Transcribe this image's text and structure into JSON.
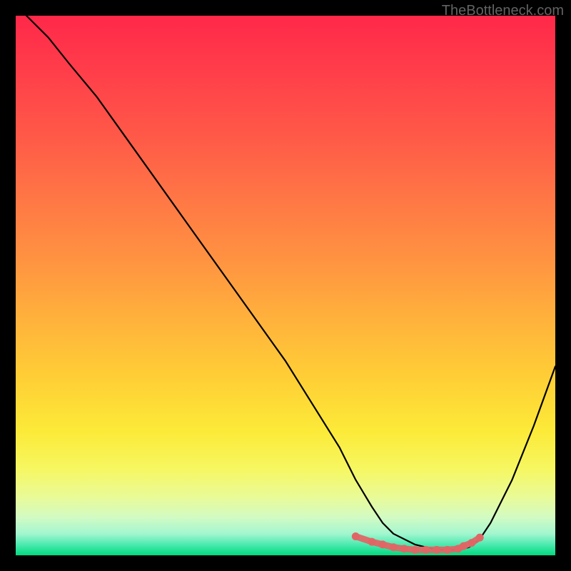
{
  "attribution": "TheBottleneck.com",
  "chart_data": {
    "type": "line",
    "title": "",
    "xlabel": "",
    "ylabel": "",
    "xlim": [
      0,
      100
    ],
    "ylim": [
      0,
      100
    ],
    "series": [
      {
        "name": "main-curve",
        "color": "#000000",
        "x": [
          2,
          6,
          10,
          15,
          20,
          25,
          30,
          35,
          40,
          45,
          50,
          55,
          60,
          63,
          66,
          68,
          70,
          74,
          78,
          82,
          84,
          86,
          88,
          92,
          96,
          100
        ],
        "y": [
          100,
          96,
          91,
          85,
          78,
          71,
          64,
          57,
          50,
          43,
          36,
          28,
          20,
          14,
          9,
          6,
          4,
          2,
          1,
          1,
          1.5,
          3,
          6,
          14,
          24,
          35
        ]
      },
      {
        "name": "highlight-dots",
        "color": "#e06666",
        "x": [
          63,
          66,
          68,
          70,
          72,
          74,
          76,
          78,
          80,
          82,
          83,
          84.5,
          86
        ],
        "y": [
          3.5,
          2.5,
          2,
          1.5,
          1.2,
          1,
          1,
          1,
          1,
          1.2,
          1.7,
          2.3,
          3.3
        ]
      }
    ],
    "gradient_stops": [
      {
        "pos": 0,
        "color": "#ff2849"
      },
      {
        "pos": 9,
        "color": "#ff3b4a"
      },
      {
        "pos": 22,
        "color": "#ff5848"
      },
      {
        "pos": 34,
        "color": "#ff7745"
      },
      {
        "pos": 45,
        "color": "#ff9241"
      },
      {
        "pos": 56,
        "color": "#ffb13c"
      },
      {
        "pos": 68,
        "color": "#ffd135"
      },
      {
        "pos": 77,
        "color": "#fcea38"
      },
      {
        "pos": 84,
        "color": "#f6f761"
      },
      {
        "pos": 89,
        "color": "#eafb95"
      },
      {
        "pos": 93,
        "color": "#d2fbc3"
      },
      {
        "pos": 96,
        "color": "#a2f6cf"
      },
      {
        "pos": 98,
        "color": "#4deab0"
      },
      {
        "pos": 100,
        "color": "#00db7e"
      }
    ]
  }
}
